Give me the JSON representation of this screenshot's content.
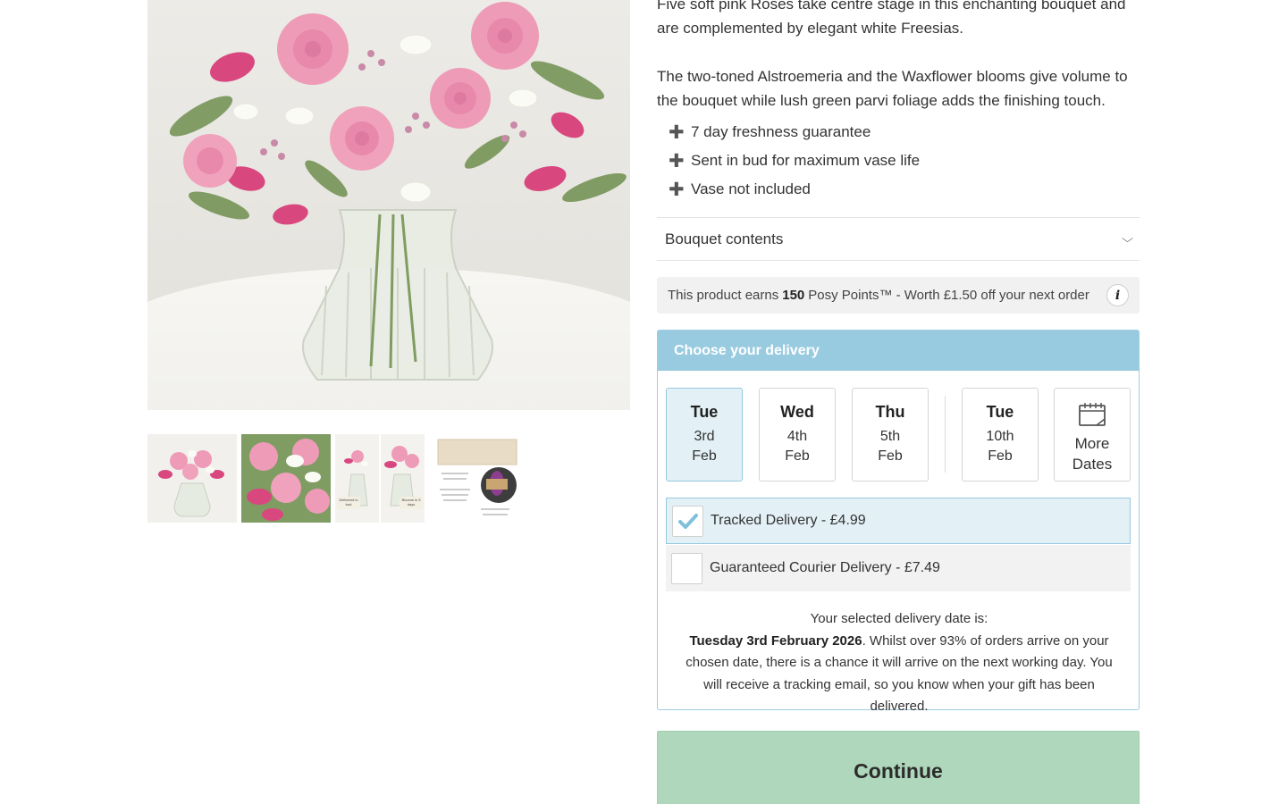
{
  "product": {
    "description_1": "Five soft pink Roses take centre stage in this enchanting bouquet and are complemented by elegant white Freesias.",
    "description_2": "The two-toned Alstroemeria and the Waxflower blooms give volume to the bouquet while lush green parvi foliage adds the finishing touch.",
    "features": [
      {
        "icon": "plus-icon",
        "label": "7 day freshness guarantee"
      },
      {
        "icon": "plus-icon",
        "label": "Sent in bud for maximum vase life"
      },
      {
        "icon": "plus-icon",
        "label": "Vase not included"
      }
    ],
    "accordion_label": "Bouquet contents",
    "thumbnails": [
      {
        "alt": "Bouquet in vase"
      },
      {
        "alt": "Close-up of bouquet"
      },
      {
        "alt": "Delivered in bud and blooms in 7 days comparison",
        "left_caption": "Delivered in bud",
        "right_caption": "Blooms in 3 days"
      },
      {
        "alt": "Letterbox gift box packaging"
      }
    ]
  },
  "points": {
    "prefix": "This product earns",
    "amount": "150",
    "suffix": "Posy Points™ - Worth £1.50 off your next order",
    "info_icon": "info-icon"
  },
  "delivery": {
    "title": "Choose your delivery",
    "dates": [
      {
        "day": "Tue",
        "date": "3rd",
        "month": "Feb",
        "selected": true
      },
      {
        "day": "Wed",
        "date": "4th",
        "month": "Feb",
        "selected": false
      },
      {
        "day": "Thu",
        "date": "5th",
        "month": "Feb",
        "selected": false
      },
      {
        "day": "Tue",
        "date": "10th",
        "month": "Feb",
        "selected": false
      }
    ],
    "more_dates": {
      "line1": "More",
      "line2": "Dates",
      "icon": "calendar-icon"
    },
    "options": [
      {
        "label": "Tracked Delivery - £4.99",
        "selected": true
      },
      {
        "label": "Guaranteed Courier Delivery - £7.49",
        "selected": false
      }
    ],
    "selected_heading": "Your selected delivery date is:",
    "selected_date": "Tuesday 3rd February 2026",
    "selected_text": ". Whilst over 93% of orders arrive on your chosen date, there is a chance it will arrive on the next working day. You will receive a tracking email, so you know when your gift has been delivered."
  },
  "actions": {
    "continue_label": "Continue"
  },
  "colors": {
    "delivery_header": "#99cbe0",
    "selected_fill": "#e3f0f6",
    "continue_button": "#afd7bb",
    "check_mark": "#7fc0dc"
  }
}
